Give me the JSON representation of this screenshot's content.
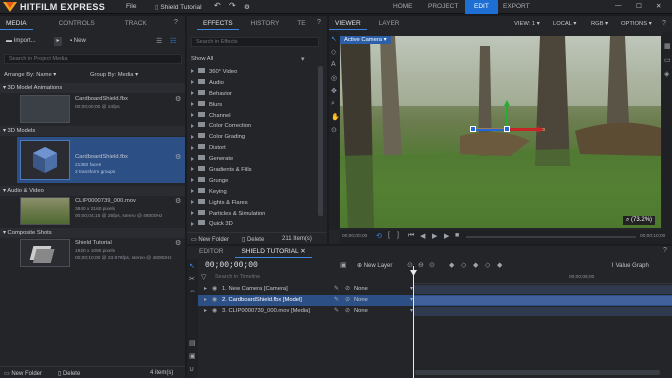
{
  "app": {
    "brand": "HITFILM EXPRESS",
    "menu": [
      "File",
      "Shield Tutorial"
    ],
    "nav_tabs": [
      "HOME",
      "PROJECT",
      "EDIT",
      "EXPORT"
    ],
    "active_nav": "EDIT",
    "accent": "#1d6fd4"
  },
  "media_panel": {
    "tabs": [
      "MEDIA",
      "CONTROLS",
      "TRACK"
    ],
    "import_label": "Import...",
    "new_label": "New",
    "search_placeholder": "Search in Project Media",
    "arrange_label": "Arrange By: Name",
    "group_label": "Group By: Media",
    "sections": [
      {
        "title": "3D Model Animations",
        "items": [
          {
            "name": "CardboardShield.fbx",
            "line1": "00;00;00;00 @ 24fps",
            "line2": ""
          }
        ]
      },
      {
        "title": "3D Models",
        "items": [
          {
            "name": "CardboardShield.fbx",
            "line1": "21382 faces",
            "line2": "2 transform groups"
          }
        ]
      },
      {
        "title": "Audio & Video",
        "items": [
          {
            "name": "CLIP0000739_000.mov",
            "line1": "3840 x 2160 pixels",
            "line2": "00;00;04;15 @ 25fps, stereo @ 48000Hz"
          }
        ]
      },
      {
        "title": "Composite Shots",
        "items": [
          {
            "name": "Shield Tutorial",
            "line1": "1920 x 1080 pixels",
            "line2": "00;00;10;00 @ 23.976fps, stereo @ 48000Hz"
          }
        ]
      }
    ],
    "footer": {
      "new_folder": "New Folder",
      "delete": "Delete",
      "count": "4 item(s)"
    }
  },
  "effects_panel": {
    "tabs": [
      "EFFECTS",
      "HISTORY",
      "TE"
    ],
    "search_placeholder": "Search in Effects",
    "show_all": "Show All",
    "categories": [
      "360° Video",
      "Audio",
      "Behavior",
      "Blurs",
      "Channel",
      "Color Correction",
      "Color Grading",
      "Distort",
      "Generate",
      "Gradients & Fills",
      "Grunge",
      "Keying",
      "Lights & Flares",
      "Particles & Simulation",
      "Quick 3D"
    ],
    "footer": {
      "new_folder": "New Folder",
      "delete": "Delete",
      "count": "211 Item(s)"
    }
  },
  "viewer": {
    "tabs": [
      "VIEWER",
      "LAYER"
    ],
    "view_label": "VIEW: 1",
    "local_label": "LOCAL",
    "rgb_label": "RGB",
    "options_label": "OPTIONS",
    "camera_label": "Active Camera",
    "zoom": "(73.2%)",
    "time_start": "00;00;00;00",
    "time_end": "00;00;10;00"
  },
  "timeline": {
    "tabs": [
      "EDITOR",
      "SHIELD TUTORIAL"
    ],
    "timecode": "00;00;00;00",
    "new_layer": "New Layer",
    "value_graph": "Value Graph",
    "search_placeholder": "Search in Timeline",
    "ruler_mark": "00;00;05;00",
    "layers": [
      {
        "name": "1. New Camera [Camera]",
        "blend": "None",
        "selected": false
      },
      {
        "name": "2. CardboardShield.fbx [Model]",
        "blend": "None",
        "selected": true
      },
      {
        "name": "3. CLIP0000739_000.mov [Media]",
        "blend": "None",
        "selected": false
      }
    ]
  }
}
